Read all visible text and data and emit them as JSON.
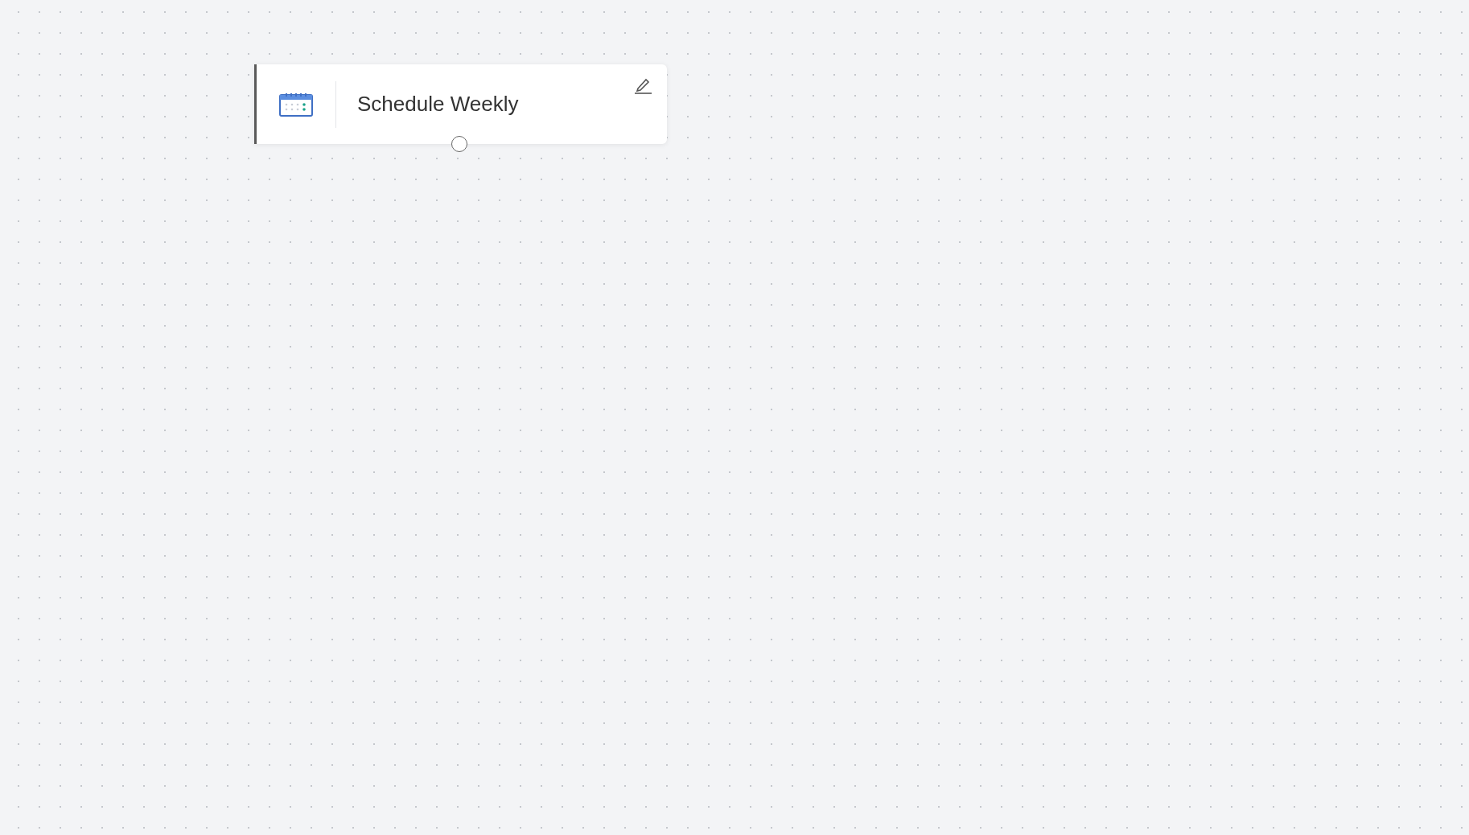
{
  "canvas": {
    "nodes": [
      {
        "kind": "trigger",
        "title": "Schedule Weekly"
      }
    ]
  }
}
